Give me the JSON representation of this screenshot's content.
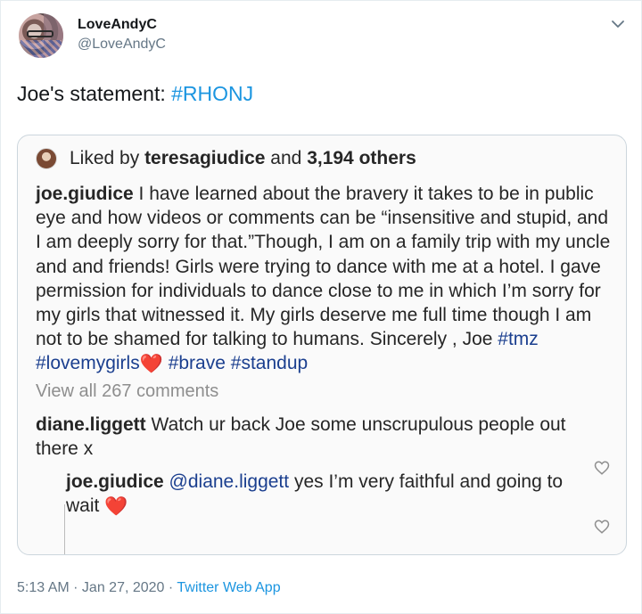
{
  "author": {
    "display_name": "LoveAndyC",
    "handle": "@LoveAndyC"
  },
  "tweet": {
    "text_prefix": "Joe's statement: ",
    "hashtag": "#RHONJ"
  },
  "quoted_post": {
    "liked_prefix": "Liked by ",
    "liked_user": "teresagiudice",
    "liked_and": " and ",
    "liked_count": "3,194 others",
    "caption_user": "joe.giudice",
    "caption_text": " I have learned about the bravery it takes to be in public eye and how videos or comments can be “insensitive and stupid, and I am deeply sorry for that.”Though, I am on a family trip with my uncle and and friends! Girls were trying to dance with me at a hotel. I gave permission for individuals to dance close to me in which I’m sorry for my girls that witnessed it. My girls deserve me full time though I am not to be shamed for talking to humans. Sincerely , Joe ",
    "caption_tags": [
      "#tmz",
      "#lovemygirls",
      "#brave",
      "#standup"
    ],
    "view_all": "View all 267 comments",
    "comments": [
      {
        "user": "diane.liggett",
        "text": " Watch ur back Joe some unscrupulous people out there x"
      }
    ],
    "replies": [
      {
        "user": "joe.giudice",
        "mention": "@diane.liggett",
        "text": " yes I’m very faithful and going to wait "
      }
    ]
  },
  "meta": {
    "time": "5:13 AM",
    "sep1": " · ",
    "date": "Jan 27, 2020",
    "sep2": " · ",
    "source": "Twitter Web App"
  },
  "colors": {
    "link": "#1b95e0",
    "ig_tag": "#1b3f8f",
    "heart": "#e0245e"
  }
}
